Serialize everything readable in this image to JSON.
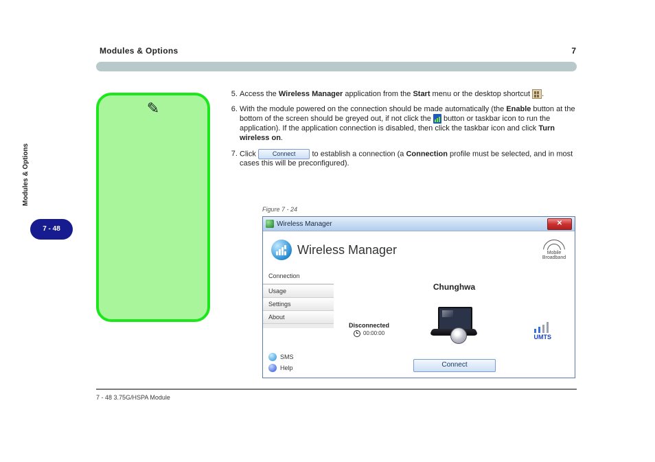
{
  "header": {
    "left": "Modules & Options",
    "right": "7"
  },
  "side_section": "Modules & Options",
  "page_number": "7 - 48",
  "body": {
    "items": [
      "Access the <b>Wireless Manager</b> application from the <b>Start</b> menu or the desktop shortcut <span class='inline-icon' data-name='desktop-shortcut-icon' data-interactable='false'></span>.",
      "With the module powered on the connection should be made automatically (the <b>Enable</b> button at the bottom of the screen should be greyed out, if not click the <span class='inline-icon-wm' data-name='wireless-manager-taskbar-icon' data-interactable='false'></span> button or taskbar icon to run the application). If the application connection is disabled, then click the taskbar icon and click <b>Turn wireless on</b>.",
      "Click <span class='btn-sm' data-name='connect-button-inline' data-interactable='false'>Connect</span> to establish a connection (a <b>Connection</b> profile must be selected, and in most cases this will be preconfigured)."
    ]
  },
  "fig_caption": "Figure 7 - 24",
  "wm": {
    "window_title": "Wireless Manager",
    "app_title": "Wireless Manager",
    "badge1": "Mobile",
    "badge2": "Broadband",
    "tabs": {
      "connection": "Connection",
      "usage": "Usage",
      "settings": "Settings",
      "about": "About"
    },
    "links": {
      "sms": "SMS",
      "help": "Help"
    },
    "carrier": "Chunghwa",
    "status": "Disconnected",
    "clock": "00:00:00",
    "umts": "UMTS",
    "connect": "Connect"
  },
  "footer": {
    "left": "7 - 48  3.75G/HSPA Module",
    "right": ""
  }
}
